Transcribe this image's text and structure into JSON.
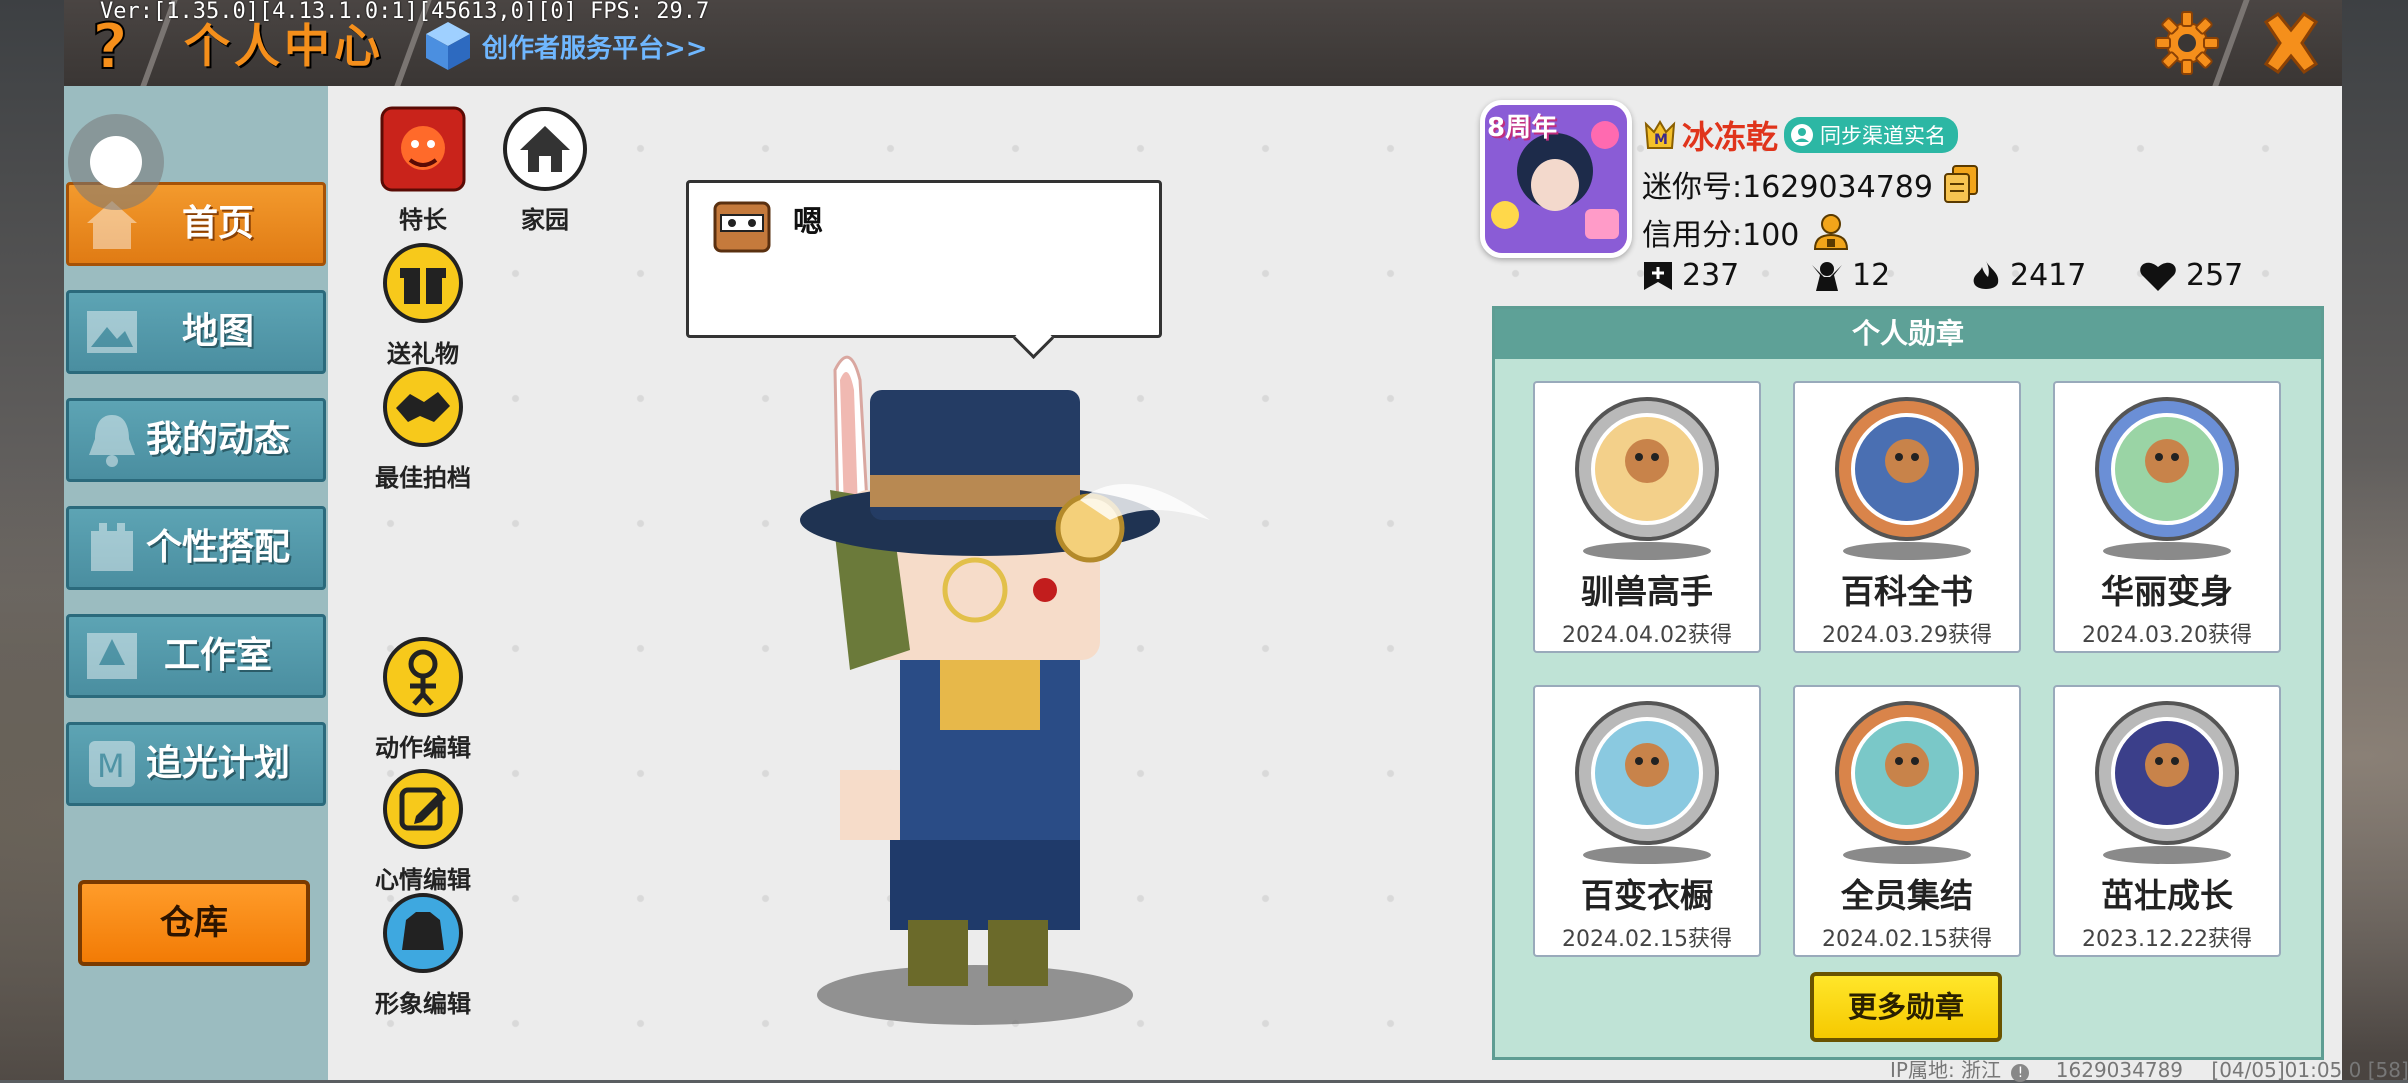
{
  "debug": "Ver:[1.35.0][4.13.1.0:1][45613,0][0] FPS: 29.7",
  "header": {
    "help": "?",
    "title": "个人中心",
    "creator_link": "创作者服务平台>>"
  },
  "sidebar": {
    "items": [
      {
        "label": "首页",
        "active": true
      },
      {
        "label": "地图"
      },
      {
        "label": "我的动态"
      },
      {
        "label": "个性搭配"
      },
      {
        "label": "工作室"
      },
      {
        "label": "追光计划"
      }
    ],
    "warehouse": "仓库"
  },
  "features": {
    "specialty": "特长",
    "home": "家园",
    "gift": "送礼物",
    "best_photo": "最佳拍档",
    "action_edit": "动作编辑",
    "mood_edit": "心情编辑",
    "image_edit": "形象编辑"
  },
  "bubble": {
    "text": "嗯"
  },
  "profile": {
    "avatar_badge": "8周年",
    "username": "冰冻乾",
    "realname_tag": "同步渠道实名",
    "mini_id": "迷你号:1629034789",
    "credit": "信用分:100",
    "stats": {
      "posts": "237",
      "followers": "12",
      "popularity": "2417",
      "likes": "257"
    }
  },
  "medals": {
    "title": "个人勋章",
    "items": [
      {
        "name": "驯兽高手",
        "date": "2024.04.02获得",
        "color": "#b9b9b9",
        "inner": "#f3d08a"
      },
      {
        "name": "百科全书",
        "date": "2024.03.29获得",
        "color": "#d9844a",
        "inner": "#4a6fb2"
      },
      {
        "name": "华丽变身",
        "date": "2024.03.20获得",
        "color": "#6b8fd6",
        "inner": "#9ad4a5"
      },
      {
        "name": "百变衣橱",
        "date": "2024.02.15获得",
        "color": "#b9b9b9",
        "inner": "#8ac9e0"
      },
      {
        "name": "全员集结",
        "date": "2024.02.15获得",
        "color": "#d9844a",
        "inner": "#7ac8c8"
      },
      {
        "name": "茁壮成长",
        "date": "2023.12.22获得",
        "color": "#b9b9b9",
        "inner": "#3b3f8a"
      }
    ],
    "more": "更多勋章"
  },
  "footer": {
    "ip": "IP属地: 浙江",
    "uid": "1629034789",
    "time": "[04/05]01:05 0 [58]"
  }
}
